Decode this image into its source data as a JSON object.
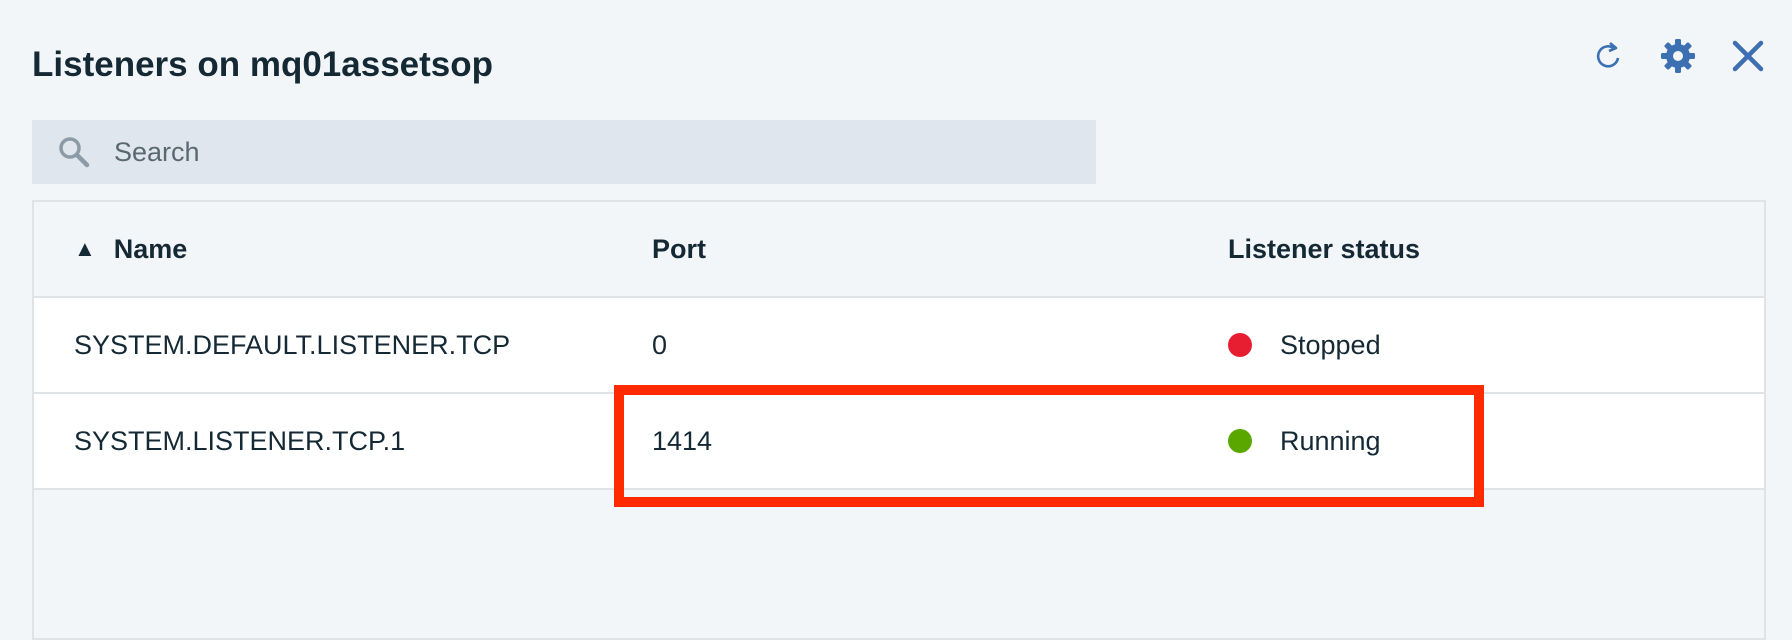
{
  "header": {
    "title": "Listeners on mq01assetsop"
  },
  "toolbar": {
    "refresh_icon": "refresh-icon",
    "settings_icon": "gear-icon",
    "close_icon": "close-icon",
    "color": "#3d70b2"
  },
  "search": {
    "placeholder": "Search",
    "value": ""
  },
  "table": {
    "sort_indicator": "▲",
    "columns": [
      "Name",
      "Port",
      "Listener status"
    ],
    "rows": [
      {
        "name": "SYSTEM.DEFAULT.LISTENER.TCP",
        "port": "0",
        "status": "Stopped",
        "status_color": "#e71d32"
      },
      {
        "name": "SYSTEM.LISTENER.TCP.1",
        "port": "1414",
        "status": "Running",
        "status_color": "#5aa700"
      }
    ]
  },
  "highlight_color": "#ff2a00"
}
